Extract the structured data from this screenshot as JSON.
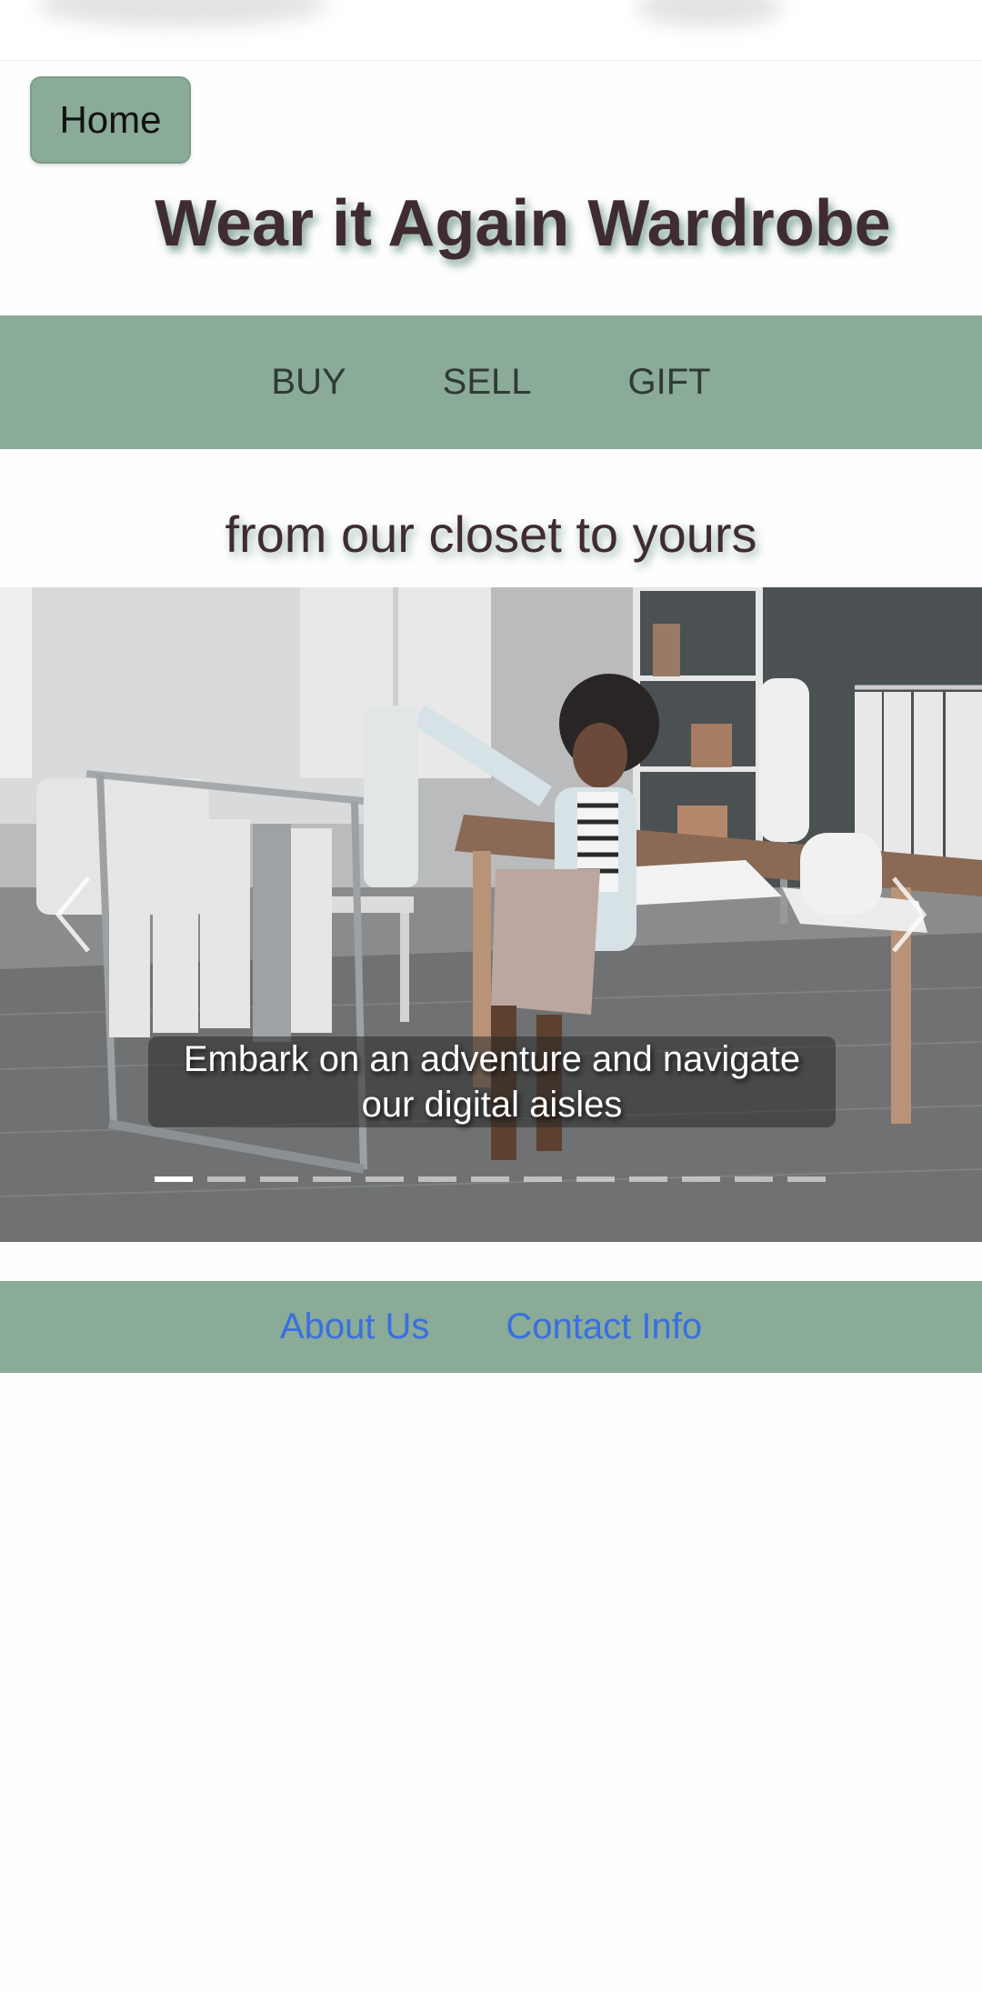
{
  "header": {
    "home_label": "Home",
    "site_title": "Wear it Again Wardrobe"
  },
  "nav": {
    "items": [
      {
        "label": "BUY"
      },
      {
        "label": "SELL"
      },
      {
        "label": "GIFT"
      }
    ]
  },
  "tagline": "from our closet to yours",
  "carousel": {
    "caption_line1": "Embark on an adventure and navigate",
    "caption_line2": "our digital aisles",
    "slide_count": 13,
    "active_index": 0
  },
  "footer": {
    "links": [
      {
        "label": "About Us"
      },
      {
        "label": "Contact Info"
      }
    ]
  },
  "colors": {
    "accent_green": "#89ab98",
    "title_color": "#3f2c33",
    "link_blue": "#3a6fe0"
  }
}
